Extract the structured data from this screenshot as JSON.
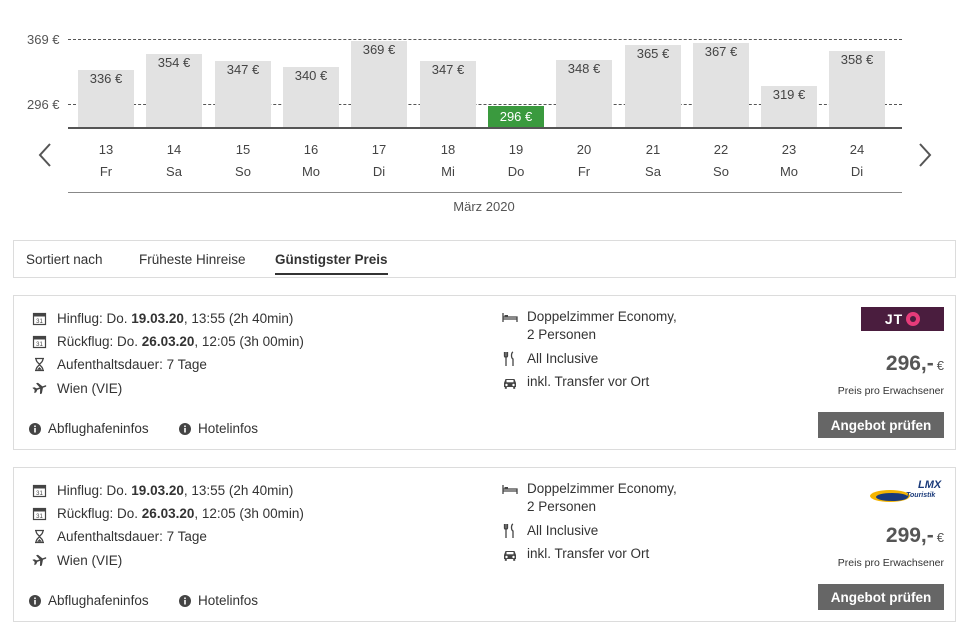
{
  "chart": {
    "y_axis_labels": [
      "369 €",
      "296 €"
    ],
    "month_label": "März 2020",
    "prev_arrow_icon": "chevron-left-icon",
    "next_arrow_icon": "chevron-right-icon",
    "bar_color": "#e2e2e2",
    "cheapest_color": "#3a9a3e"
  },
  "chart_data": {
    "type": "bar",
    "categories": [
      "13 Fr",
      "14 Sa",
      "15 So",
      "16 Mo",
      "17 Di",
      "18 Mi",
      "19 Do",
      "20 Fr",
      "21 Sa",
      "22 So",
      "23 Mo",
      "24 Di"
    ],
    "values": [
      336,
      354,
      347,
      340,
      369,
      347,
      296,
      348,
      365,
      367,
      319,
      358
    ],
    "value_labels": [
      "336 €",
      "354 €",
      "347 €",
      "340 €",
      "369 €",
      "347 €",
      "296 €",
      "348 €",
      "365 €",
      "367 €",
      "319 €",
      "358 €"
    ],
    "days": [
      {
        "num": "13",
        "wd": "Fr"
      },
      {
        "num": "14",
        "wd": "Sa"
      },
      {
        "num": "15",
        "wd": "So"
      },
      {
        "num": "16",
        "wd": "Mo"
      },
      {
        "num": "17",
        "wd": "Di"
      },
      {
        "num": "18",
        "wd": "Mi"
      },
      {
        "num": "19",
        "wd": "Do"
      },
      {
        "num": "20",
        "wd": "Fr"
      },
      {
        "num": "21",
        "wd": "Sa"
      },
      {
        "num": "22",
        "wd": "So"
      },
      {
        "num": "23",
        "wd": "Mo"
      },
      {
        "num": "24",
        "wd": "Di"
      }
    ],
    "reference_values": [
      369,
      296
    ],
    "highlight_index": 6,
    "xlabel": "März 2020",
    "ylim": [
      269,
      369
    ],
    "grid": false,
    "legend": "none"
  },
  "sort": {
    "label": "Sortiert nach",
    "options": [
      "Früheste Hinreise",
      "Günstigster Preis"
    ],
    "active": "Günstigster Preis"
  },
  "offers": [
    {
      "outbound_prefix": "Hinflug: Do. ",
      "outbound_date": "19.03.20",
      "outbound_suffix": ", 13:55 (2h 40min)",
      "return_prefix": "Rückflug: Do. ",
      "return_date": "26.03.20",
      "return_suffix": ", 12:05 (3h 00min)",
      "stay": "Aufenthaltsdauer: 7 Tage",
      "airport": "Wien (VIE)",
      "room_line1": "Doppelzimmer Economy,",
      "room_line2": "2 Personen",
      "board": "All Inclusive",
      "transfer": "inkl. Transfer vor Ort",
      "airport_info": "Abflughafeninfos",
      "hotel_info": "Hotelinfos",
      "price": "296,-",
      "currency": "€",
      "price_note": "Preis pro Erwachsener",
      "cta": "Angebot prüfen",
      "operator_logo_text": "JT",
      "operator_logo_icon": "jt-touristik-logo"
    },
    {
      "outbound_prefix": "Hinflug: Do. ",
      "outbound_date": "19.03.20",
      "outbound_suffix": ", 13:55 (2h 40min)",
      "return_prefix": "Rückflug: Do. ",
      "return_date": "26.03.20",
      "return_suffix": ", 12:05 (3h 00min)",
      "stay": "Aufenthaltsdauer: 7 Tage",
      "airport": "Wien (VIE)",
      "room_line1": "Doppelzimmer Economy,",
      "room_line2": "2 Personen",
      "board": "All Inclusive",
      "transfer": "inkl. Transfer vor Ort",
      "airport_info": "Abflughafeninfos",
      "hotel_info": "Hotelinfos",
      "price": "299,-",
      "currency": "€",
      "price_note": "Preis pro Erwachsener",
      "cta": "Angebot prüfen",
      "operator_logo_text": "LMX Touristik",
      "operator_logo_icon": "lmx-touristik-logo"
    }
  ]
}
